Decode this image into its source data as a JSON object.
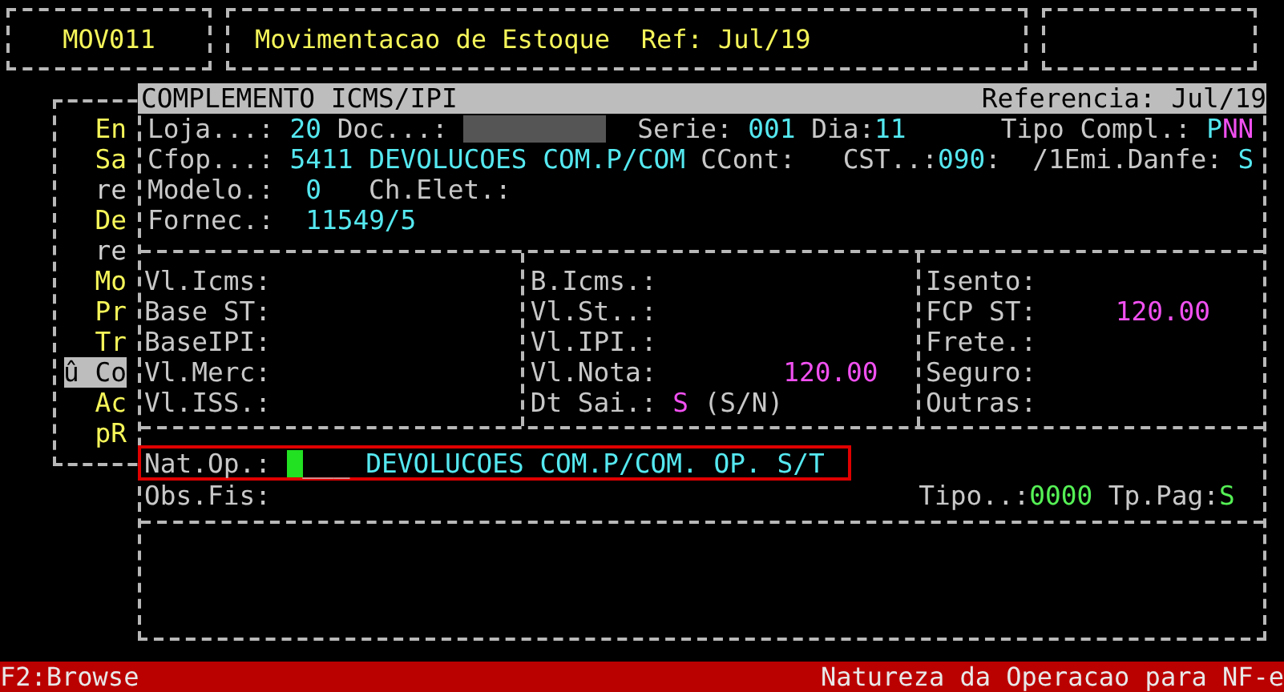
{
  "header": {
    "program_code": "MOV011",
    "title": "Movimentacao de Estoque  Ref: Jul/19"
  },
  "menu": {
    "items": [
      {
        "label": "En",
        "selected": false,
        "disabled": false
      },
      {
        "label": "Sa",
        "selected": false,
        "disabled": false
      },
      {
        "label": "re",
        "selected": false,
        "disabled": true
      },
      {
        "label": "De",
        "selected": false,
        "disabled": false
      },
      {
        "label": "re",
        "selected": false,
        "disabled": true
      },
      {
        "label": "Mo",
        "selected": false,
        "disabled": false
      },
      {
        "label": "Pr",
        "selected": false,
        "disabled": false
      },
      {
        "label": "Tr",
        "selected": false,
        "disabled": false
      },
      {
        "label": "û Co",
        "selected": true,
        "disabled": false
      },
      {
        "label": "Ac",
        "selected": false,
        "disabled": false
      },
      {
        "label": "pR",
        "selected": false,
        "disabled": false
      }
    ]
  },
  "dialog": {
    "title": "COMPLEMENTO ICMS/IPI",
    "reference": "Referencia: Jul/19",
    "header_rows": [
      [
        {
          "kind": "label",
          "text": "Loja...:"
        },
        {
          "kind": "value",
          "text": "20"
        },
        {
          "kind": "label",
          "text": "Doc...:"
        },
        {
          "kind": "masked"
        },
        {
          "kind": "label",
          "text": "Serie:"
        },
        {
          "kind": "value",
          "text": "001"
        },
        {
          "kind": "label",
          "text": "Dia:"
        },
        {
          "kind": "value",
          "text": "11"
        },
        {
          "kind": "label",
          "text": "Tipo Compl.:"
        },
        {
          "kind": "value",
          "text": "P"
        },
        {
          "kind": "accent",
          "text": "NN"
        }
      ],
      [
        {
          "kind": "label",
          "text": "Cfop...:"
        },
        {
          "kind": "value",
          "text": "5411 DEVOLUCOES COM.P/COM"
        },
        {
          "kind": "label",
          "text": "CCont:"
        },
        {
          "kind": "label",
          "text": "CST..:"
        },
        {
          "kind": "value",
          "text": "090"
        },
        {
          "kind": "label",
          "text": ":"
        },
        {
          "kind": "label",
          "text": "/1"
        },
        {
          "kind": "label",
          "text": "Emi.Danfe:"
        },
        {
          "kind": "value",
          "text": "S"
        }
      ],
      [
        {
          "kind": "label",
          "text": "Modelo.:"
        },
        {
          "kind": "value",
          "text": "0"
        },
        {
          "kind": "label",
          "text": "Ch.Elet.:"
        }
      ],
      [
        {
          "kind": "label",
          "text": "Fornec.:"
        },
        {
          "kind": "value",
          "text": "11549/5"
        }
      ]
    ],
    "totals_columns": [
      [
        {
          "label": "Vl.Icms:"
        },
        {
          "label": "Base ST:"
        },
        {
          "label": "BaseIPI:"
        },
        {
          "label": "Vl.Merc:"
        },
        {
          "label": "Vl.ISS.:"
        }
      ],
      [
        {
          "label": "B.Icms.:"
        },
        {
          "label": "Vl.St..:"
        },
        {
          "label": "Vl.IPI.:"
        },
        {
          "label": "Vl.Nota:",
          "value": "120.00"
        },
        {
          "label": "Dt Sai.:",
          "value": "S",
          "hint": "(S/N)"
        }
      ],
      [
        {
          "label": "Isento:"
        },
        {
          "label": "FCP ST:",
          "value": "120.00"
        },
        {
          "label": "Frete.:"
        },
        {
          "label": "Seguro:"
        },
        {
          "label": "Outras:"
        }
      ]
    ],
    "nat_op": {
      "label": "Nat.Op.:",
      "value": "___",
      "description": "DEVOLUCOES COM.P/COM. OP. S/T",
      "focused": true
    },
    "obs_fis": {
      "label": "Obs.Fis:"
    },
    "tipo": {
      "label": "Tipo..:",
      "value": "0000"
    },
    "tp_pag": {
      "label": "Tp.Pag:",
      "value": "S"
    }
  },
  "status_bar": {
    "left": "F2:Browse",
    "right": "Natureza da Operacao para NF-e"
  }
}
